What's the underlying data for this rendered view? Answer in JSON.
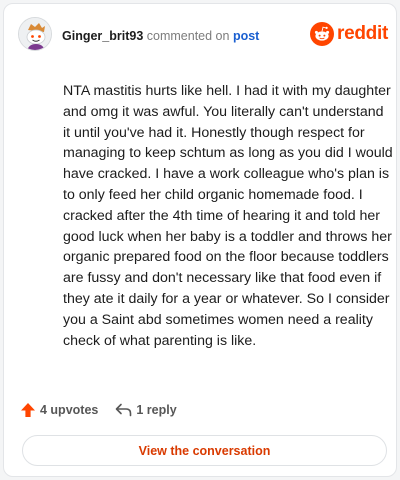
{
  "header": {
    "username": "Ginger_brit93",
    "action_text": "commented on",
    "post_link": "post"
  },
  "brand": {
    "name": "reddit",
    "color": "#ff4500",
    "icon": "reddit-snoo-icon"
  },
  "comment": {
    "text": "NTA mastitis hurts like hell. I had it with my daughter and omg it was awful. You literally can't understand it until you've had it. Honestly though respect for managing to keep schtum as long as you did I would have cracked. I have a work colleague who's plan is to only feed her child organic homemade food. I cracked after the 4th time of hearing it and told her good luck when her baby is a toddler and throws her organic prepared food on the floor because toddlers are fussy and don't necessary like that food even if they ate it daily for a year or whatever. So I consider you a Saint abd sometimes women need a reality check of what parenting is like."
  },
  "footer": {
    "upvotes": "4 upvotes",
    "upvote_icon": "upvote-arrow-icon",
    "replies": "1 reply",
    "reply_icon": "reply-arrow-icon"
  },
  "cta": {
    "label": "View the conversation",
    "color": "#d93a00"
  }
}
